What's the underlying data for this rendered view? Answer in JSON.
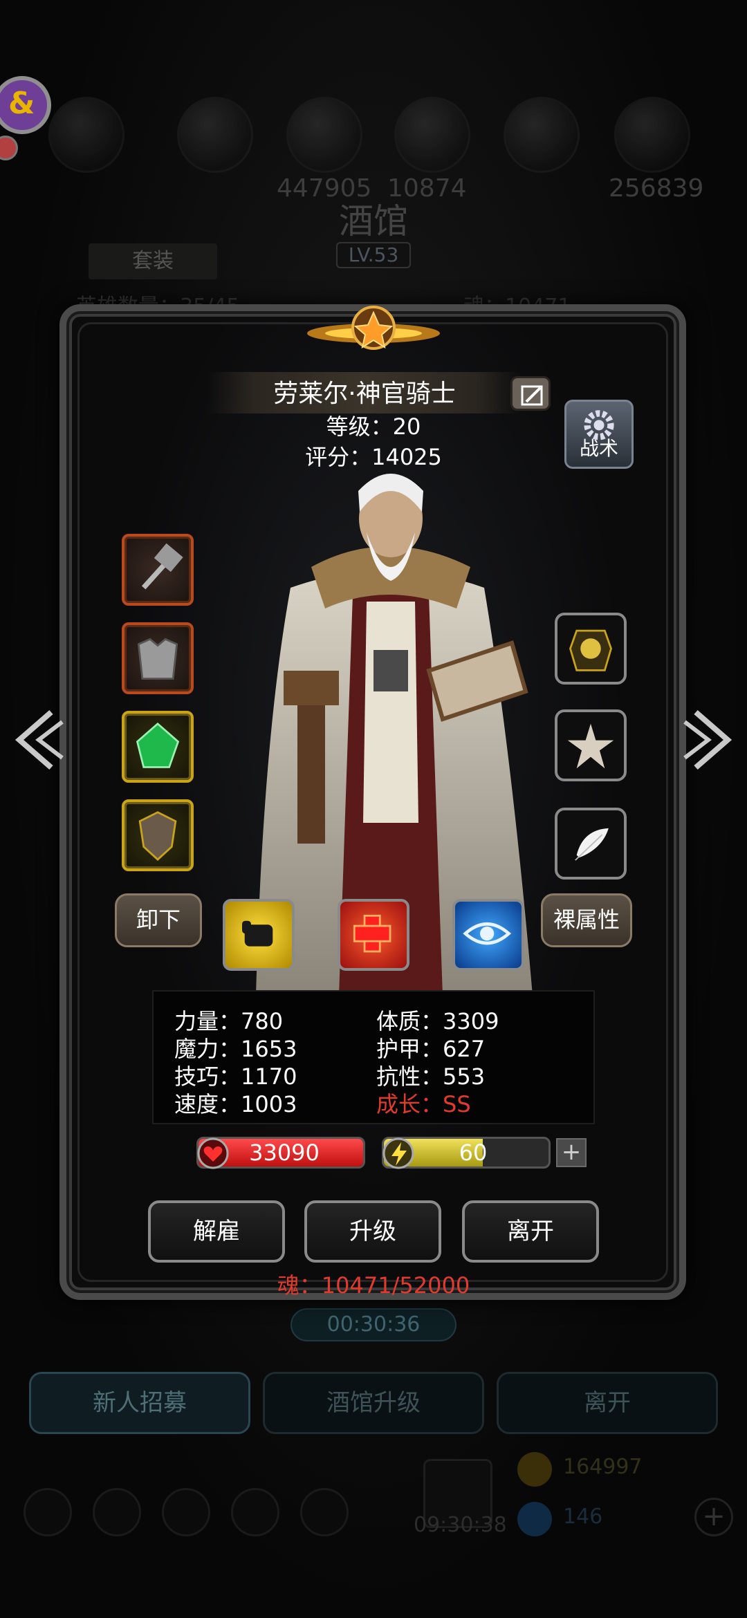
{
  "background": {
    "resource_values": [
      "447905",
      "10874",
      "256839"
    ],
    "tavern_title": "酒馆",
    "tavern_level": "LV.53",
    "suit_tab": "套装",
    "hero_count_text": "英雄数量：35/45",
    "soul_text": "魂：10471",
    "timer": "00:30:36",
    "tabs": [
      "新人招募",
      "酒馆升级",
      "离开"
    ],
    "gift_timer": "09:30:38",
    "gold": "164997",
    "gems": "146"
  },
  "hero": {
    "name": "劳莱尔·神官骑士",
    "level_text": "等级：20",
    "score_text": "评分：14025",
    "tactics_label": "战术"
  },
  "equipment": {
    "left_slots": [
      "hammer-icon",
      "armor-icon",
      "emerald-icon",
      "shield-icon"
    ],
    "right_slots": [
      "skull-amulet-icon",
      "starfish-icon",
      "feather-icon"
    ]
  },
  "buttons": {
    "unequip": "卸下",
    "base_attributes": "裸属性",
    "dismiss": "解雇",
    "upgrade": "升级",
    "leave": "离开"
  },
  "stats": {
    "strength": "力量：780",
    "magic": "魔力：1653",
    "skill": "技巧：1170",
    "speed": "速度：1003",
    "constitution": "体质：3309",
    "armor": "护甲：627",
    "resistance": "抗性：553",
    "growth": "成长：SS"
  },
  "bars": {
    "hp": "33090",
    "hp_fill": 1.0,
    "energy": "60",
    "energy_fill": 0.6
  },
  "soul_progress": "魂：10471/52000",
  "colors": {
    "growth_red": "#e23a2c",
    "hp_red": "#d41a1a",
    "energy_yellow": "#d6c52a",
    "orange_rarity": "#b84a1c",
    "yellow_rarity": "#c9a318"
  }
}
